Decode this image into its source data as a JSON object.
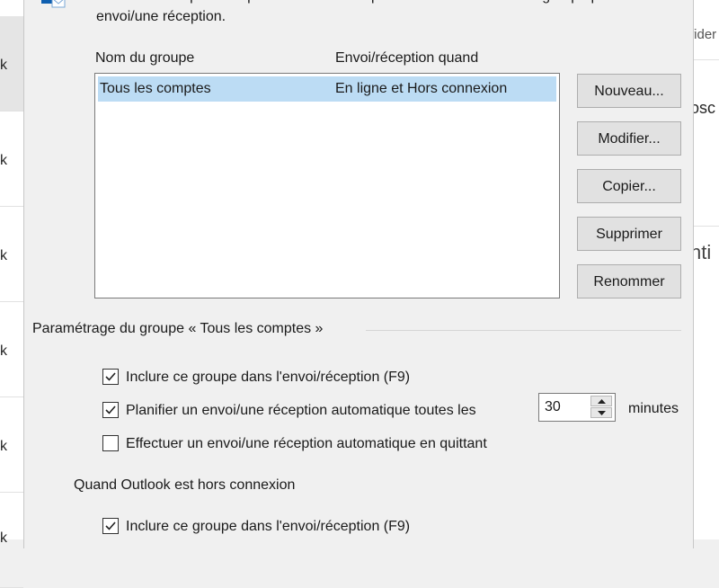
{
  "background": {
    "left_rows": [
      "k",
      "k",
      "k",
      "k",
      "k",
      "k"
    ],
    "right_fragments": [
      "fider",
      "osc",
      "nti"
    ]
  },
  "dialog": {
    "description": "Outlook. Vous pouvez spécifier les tâches qui seront exécutées sur le groupe pendant un envoi/une réception.",
    "columns": {
      "group_name": "Nom du groupe",
      "when": "Envoi/réception quand"
    },
    "groups": [
      {
        "name": "Tous les comptes",
        "when": "En ligne et Hors connexion",
        "selected": true
      }
    ],
    "buttons": {
      "new": "Nouveau...",
      "edit": "Modifier...",
      "copy": "Copier...",
      "delete": "Supprimer",
      "rename": "Renommer"
    },
    "settings": {
      "legend": "Paramétrage du groupe « Tous les comptes »",
      "include_online": {
        "label": "Inclure ce groupe dans l'envoi/réception (F9)",
        "checked": true
      },
      "schedule": {
        "label": "Planifier un envoi/une réception automatique toutes les",
        "checked": true,
        "value": "30",
        "unit": "minutes"
      },
      "on_exit": {
        "label": "Effectuer un envoi/une réception automatique en quittant",
        "checked": false
      },
      "offline_heading": "Quand Outlook est hors connexion",
      "include_offline": {
        "label": "Inclure ce groupe dans l'envoi/réception (F9)",
        "checked": true
      }
    }
  },
  "colors": {
    "selection": "#bcdcf4",
    "button_face": "#e1e1e1",
    "dialog_bg": "#f0f0f0"
  }
}
